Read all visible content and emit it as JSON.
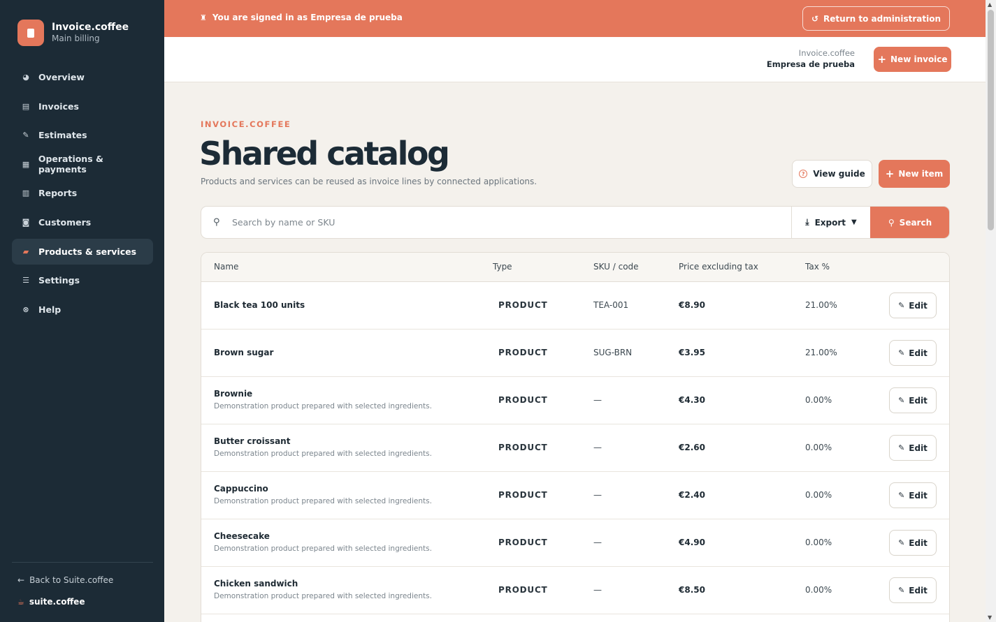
{
  "brand": {
    "title": "Invoice.coffee",
    "subtitle": "Main billing"
  },
  "sidebar": {
    "items": [
      {
        "label": "Overview",
        "icon": "pie-chart-icon"
      },
      {
        "label": "Invoices",
        "icon": "document-icon"
      },
      {
        "label": "Estimates",
        "icon": "estimate-icon"
      },
      {
        "label": "Operations & payments",
        "icon": "ledger-icon"
      },
      {
        "label": "Reports",
        "icon": "bar-chart-icon"
      },
      {
        "label": "Customers",
        "icon": "contact-card-icon"
      },
      {
        "label": "Products & services",
        "icon": "box-icon",
        "active": true
      },
      {
        "label": "Settings",
        "icon": "sliders-icon"
      },
      {
        "label": "Help",
        "icon": "help-circle-icon"
      }
    ],
    "back_label": "Back to Suite.coffee",
    "suite_label": "suite.coffee"
  },
  "banner": {
    "text": "You are signed in as Empresa de prueba",
    "return_label": "Return to administration"
  },
  "header": {
    "org_app": "Invoice.coffee",
    "org_name": "Empresa de prueba",
    "new_invoice_label": "New invoice"
  },
  "page": {
    "eyebrow": "INVOICE.COFFEE",
    "title": "Shared catalog",
    "subtitle": "Products and services can be reused as invoice lines by connected applications.",
    "guide_label": "View guide",
    "new_item_label": "New item"
  },
  "search": {
    "placeholder": "Search by name or SKU",
    "export_label": "Export",
    "search_label": "Search"
  },
  "table": {
    "columns": [
      "Name",
      "Type",
      "SKU / code",
      "Price excluding tax",
      "Tax %"
    ],
    "edit_label": "Edit",
    "rows": [
      {
        "name": "Black tea 100 units",
        "desc": "",
        "type": "PRODUCT",
        "sku": "TEA-001",
        "price": "€8.90",
        "tax": "21.00%"
      },
      {
        "name": "Brown sugar",
        "desc": "",
        "type": "PRODUCT",
        "sku": "SUG-BRN",
        "price": "€3.95",
        "tax": "21.00%"
      },
      {
        "name": "Brownie",
        "desc": "Demonstration product prepared with selected ingredients.",
        "type": "PRODUCT",
        "sku": "—",
        "price": "€4.30",
        "tax": "0.00%"
      },
      {
        "name": "Butter croissant",
        "desc": "Demonstration product prepared with selected ingredients.",
        "type": "PRODUCT",
        "sku": "—",
        "price": "€2.60",
        "tax": "0.00%"
      },
      {
        "name": "Cappuccino",
        "desc": "Demonstration product prepared with selected ingredients.",
        "type": "PRODUCT",
        "sku": "—",
        "price": "€2.40",
        "tax": "0.00%"
      },
      {
        "name": "Cheesecake",
        "desc": "Demonstration product prepared with selected ingredients.",
        "type": "PRODUCT",
        "sku": "—",
        "price": "€4.90",
        "tax": "0.00%"
      },
      {
        "name": "Chicken sandwich",
        "desc": "Demonstration product prepared with selected ingredients.",
        "type": "PRODUCT",
        "sku": "—",
        "price": "€8.50",
        "tax": "0.00%"
      }
    ]
  },
  "colors": {
    "accent": "#e4775b",
    "sidebar": "#1c2b36",
    "background": "#f4f1ec"
  }
}
